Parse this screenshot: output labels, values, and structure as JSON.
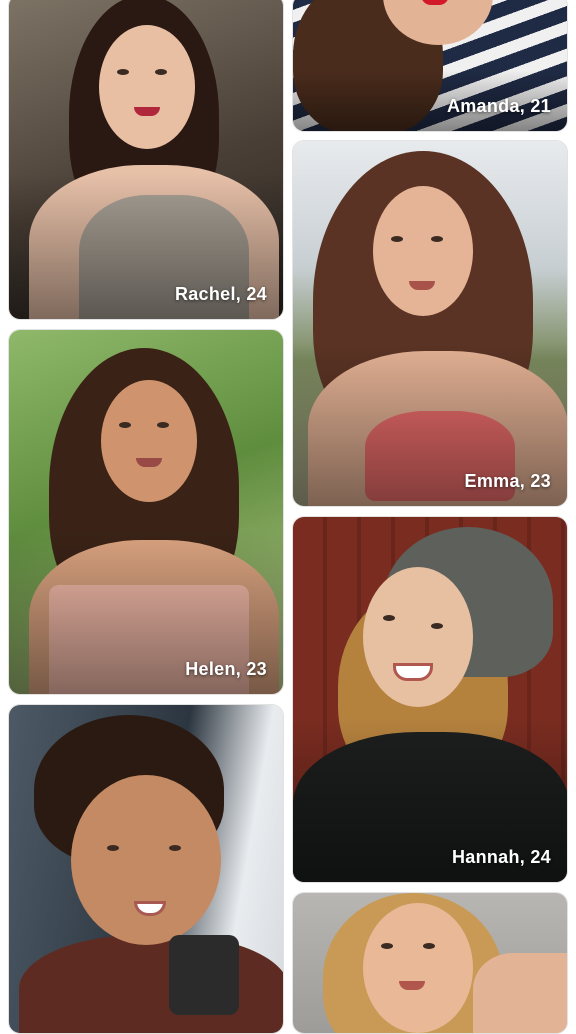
{
  "profiles": [
    {
      "id": "rachel",
      "label": "Rachel, 24"
    },
    {
      "id": "amanda",
      "label": "Amanda, 21"
    },
    {
      "id": "emma",
      "label": "Emma, 23"
    },
    {
      "id": "helen",
      "label": "Helen, 23"
    },
    {
      "id": "hannah",
      "label": "Hannah, 24"
    }
  ]
}
